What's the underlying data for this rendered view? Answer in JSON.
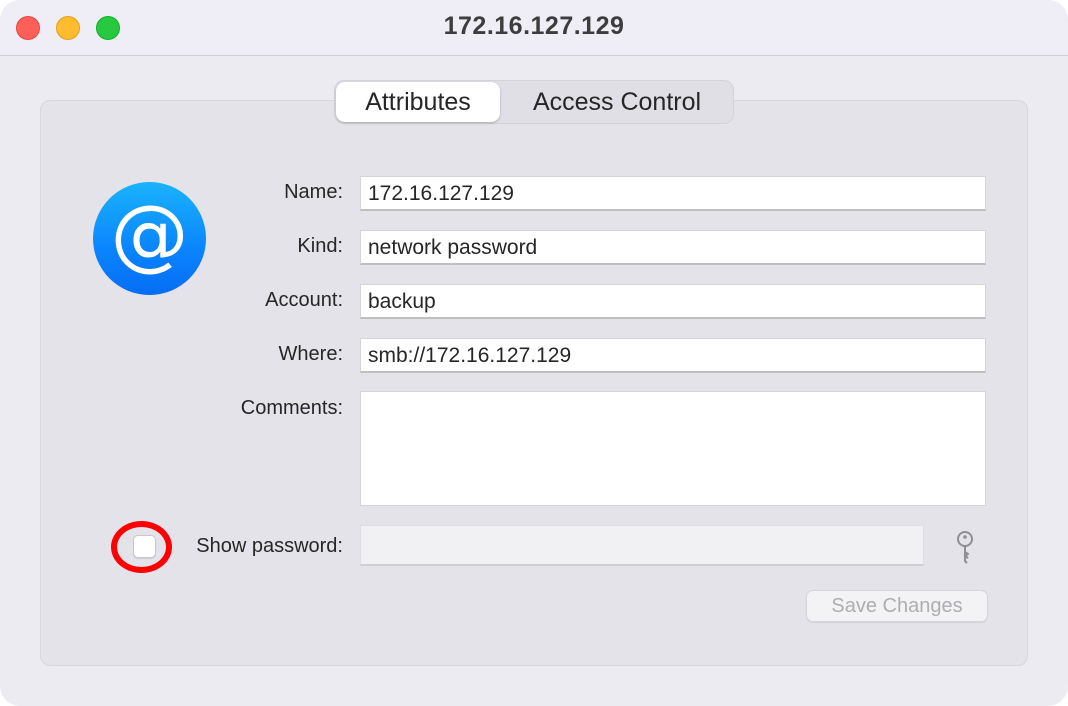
{
  "window": {
    "title": "172.16.127.129",
    "controls": {
      "close_color": "#fe5f57",
      "minimize_color": "#febc2e",
      "zoom_color": "#28c840"
    }
  },
  "tabs": [
    {
      "label": "Attributes",
      "active": true
    },
    {
      "label": "Access Control",
      "active": false
    }
  ],
  "icon": {
    "name": "at-sign-icon",
    "glyph": "@",
    "color": "#0a84ff"
  },
  "form": {
    "name_label": "Name:",
    "name_value": "172.16.127.129",
    "kind_label": "Kind:",
    "kind_value": "network password",
    "account_label": "Account:",
    "account_value": "backup",
    "where_label": "Where:",
    "where_value": "smb://172.16.127.129",
    "comments_label": "Comments:",
    "comments_value": "",
    "show_password_label": "Show password:",
    "show_password_checked": false,
    "password_value": ""
  },
  "actions": {
    "save_label": "Save Changes",
    "save_enabled": false
  },
  "annotation": {
    "color": "#ff0000",
    "target": "show-password-checkbox"
  }
}
